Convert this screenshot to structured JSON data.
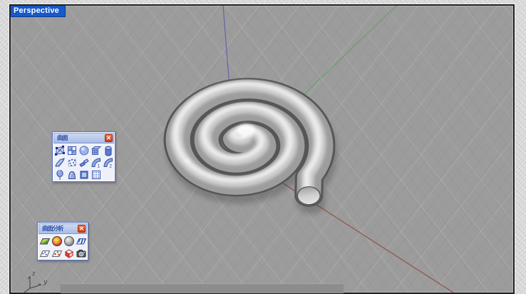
{
  "viewport": {
    "label": "Perspective",
    "axis_indicator": {
      "z_label": "z",
      "y_label": "y"
    }
  },
  "colors": {
    "viewport_bg": "#9c9c9c",
    "frame_bg": "#d8d8d8",
    "label_bg": "#1659c8",
    "label_text": "#ffffff",
    "axis_x": "#96564f",
    "axis_y": "#6d9d74",
    "axis_z": "#6767ab",
    "palette_title_bg": "#b9c9ec",
    "close_button": "#e2502c",
    "object_body": "#c2c2c2"
  },
  "toolbars": [
    {
      "title": "曲面",
      "close_glyph": "✕",
      "columns": 5,
      "icons": [
        "surface-from-corner-points",
        "surface-from-edge-curves",
        "sphere",
        "surface-from-curve-network",
        "extrude-cylinder",
        "loft",
        "patch-from-points",
        "sweep-segments",
        "sweep-1-rail",
        "sweep-2-rails",
        "revolve",
        "rail-revolve",
        "cutting-plane",
        "heightfield"
      ]
    },
    {
      "title": "曲面分析",
      "close_glyph": "✕",
      "columns": 4,
      "icons": [
        "curvature-analysis",
        "curvature-sphere",
        "environment-map",
        "zebra-analysis",
        "draft-angle-analysis",
        "deviation-analysis",
        "edge-analysis",
        "snapshot-camera"
      ]
    }
  ]
}
